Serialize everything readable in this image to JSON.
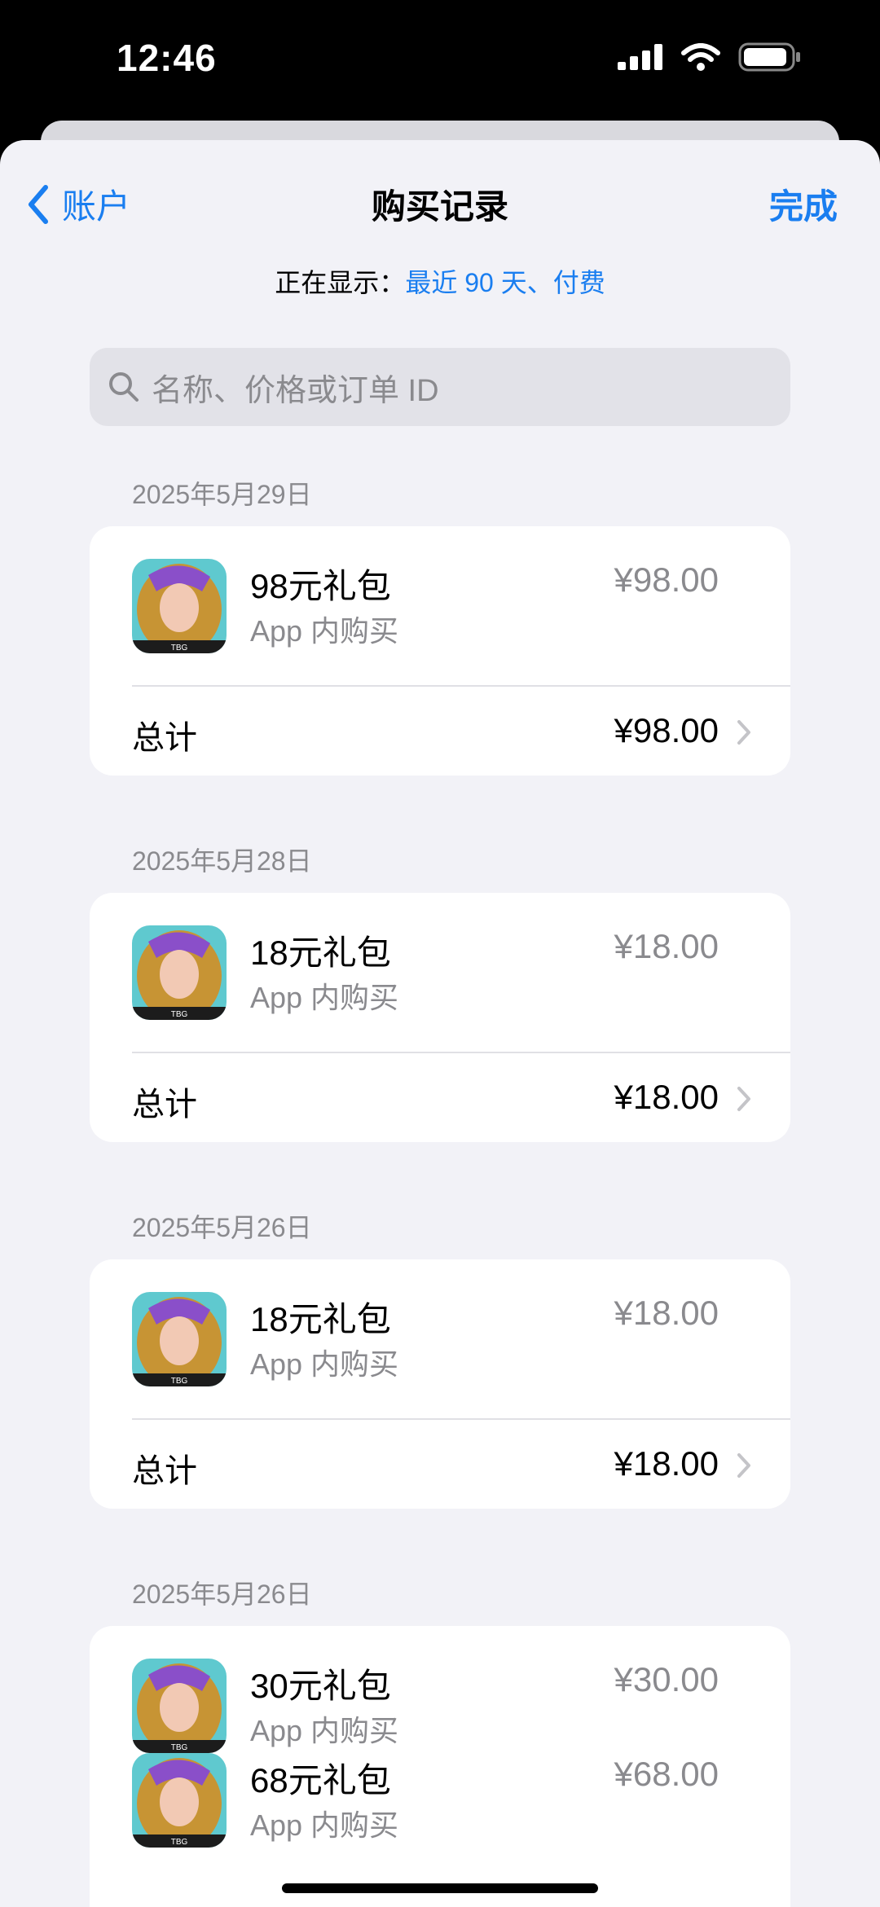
{
  "status": {
    "time": "12:46"
  },
  "nav": {
    "back_label": "账户",
    "title": "购买记录",
    "done_label": "完成"
  },
  "filter": {
    "prefix": "正在显示：",
    "value": "最近 90 天、付费"
  },
  "search": {
    "placeholder": "名称、价格或订单 ID"
  },
  "groups": [
    {
      "date": "2025年5月29日",
      "items": [
        {
          "name": "98元礼包",
          "type": "App 内购买",
          "price": "¥98.00"
        }
      ],
      "total_label": "总计",
      "total": "¥98.00"
    },
    {
      "date": "2025年5月28日",
      "items": [
        {
          "name": "18元礼包",
          "type": "App 内购买",
          "price": "¥18.00"
        }
      ],
      "total_label": "总计",
      "total": "¥18.00"
    },
    {
      "date": "2025年5月26日",
      "items": [
        {
          "name": "18元礼包",
          "type": "App 内购买",
          "price": "¥18.00"
        }
      ],
      "total_label": "总计",
      "total": "¥18.00"
    },
    {
      "date": "2025年5月26日",
      "items": [
        {
          "name": "30元礼包",
          "type": "App 内购买",
          "price": "¥30.00"
        },
        {
          "name": "68元礼包",
          "type": "App 内购买",
          "price": "¥68.00"
        }
      ]
    }
  ],
  "colors": {
    "accent": "#1a7ef0",
    "secondary_text": "#8a8a8e",
    "background": "#f2f2f7"
  },
  "icons": {
    "back": "chevron-left-icon",
    "search": "search-icon",
    "row": "chevron-right-icon",
    "app": "game-app-icon"
  }
}
